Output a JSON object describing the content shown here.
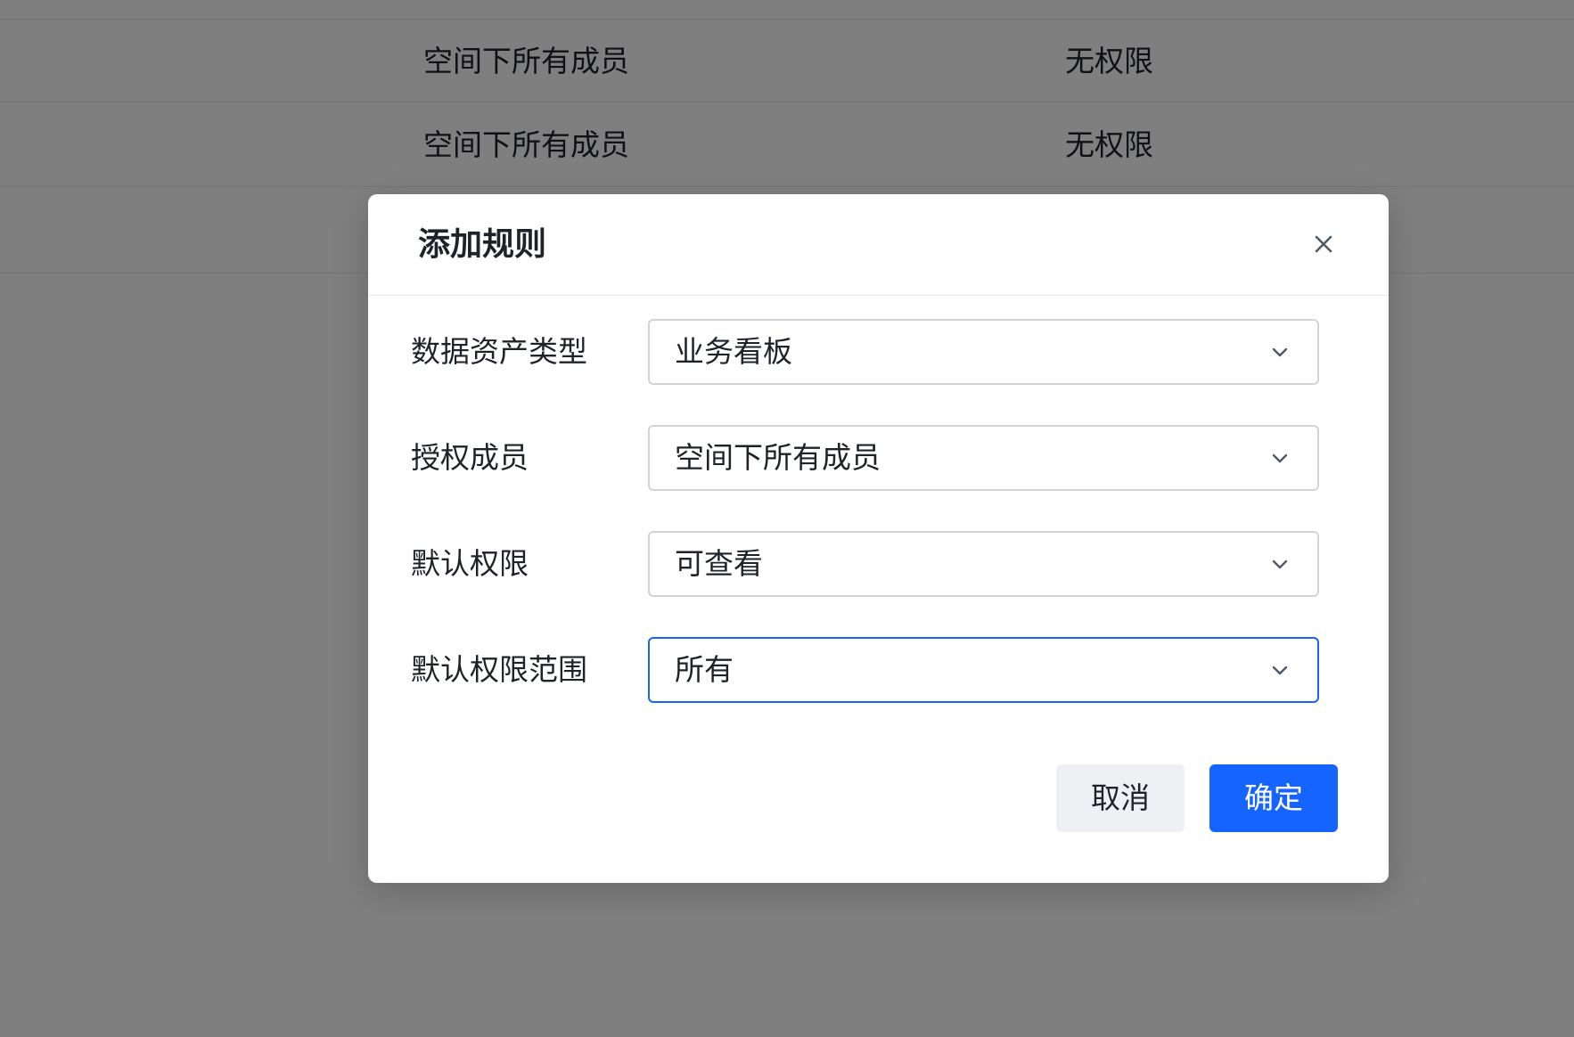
{
  "background_table": {
    "rows": [
      {
        "members": "空间下所有成员",
        "permission": "无权限"
      },
      {
        "members": "空间下所有成员",
        "permission": "无权限"
      },
      {
        "members": "",
        "permission": ""
      }
    ]
  },
  "modal": {
    "title": "添加规则",
    "close_icon": "close-icon",
    "fields": [
      {
        "label": "数据资产类型",
        "value": "业务看板",
        "focused": false
      },
      {
        "label": "授权成员",
        "value": "空间下所有成员",
        "focused": false
      },
      {
        "label": "默认权限",
        "value": "可查看",
        "focused": false
      },
      {
        "label": "默认权限范围",
        "value": "所有",
        "focused": true
      }
    ],
    "buttons": {
      "cancel": "取消",
      "confirm": "确定"
    }
  },
  "colors": {
    "primary": "#1664ff",
    "overlay": "rgba(0,0,0,0.5)",
    "text": "#1f2329",
    "border": "#d0d3d9",
    "cancel_bg": "#eef0f4"
  }
}
